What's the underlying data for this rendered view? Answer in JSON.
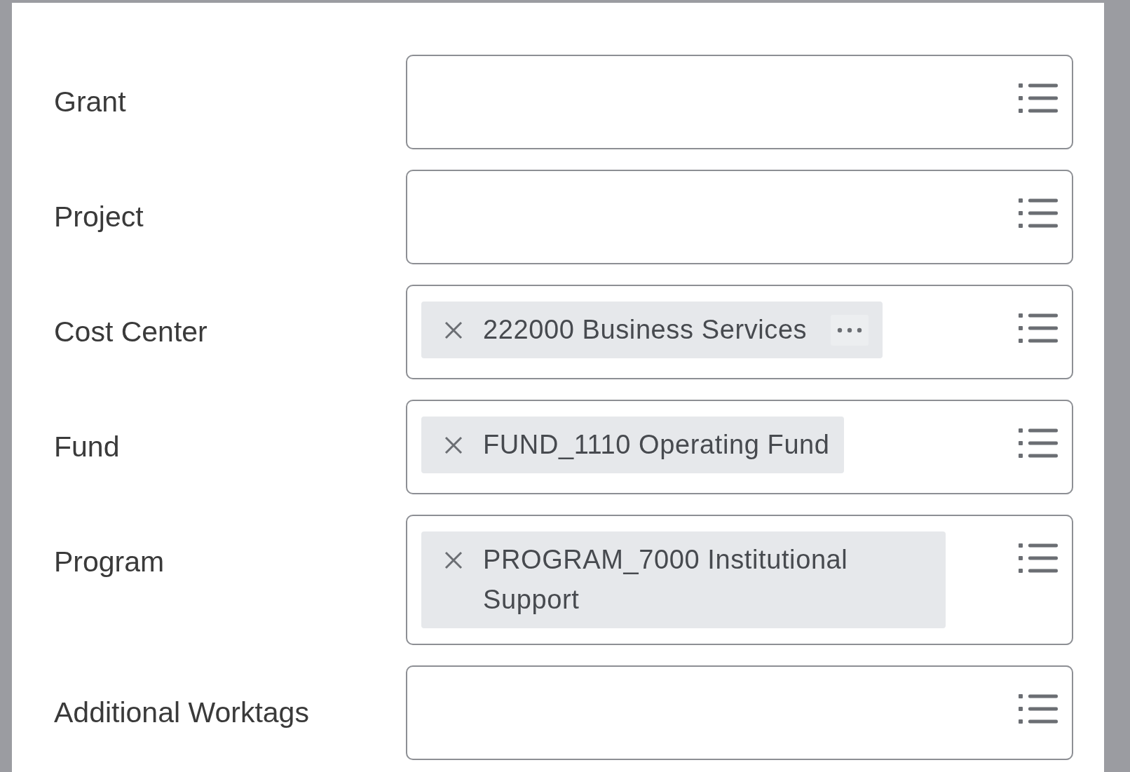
{
  "fields": [
    {
      "label": "Grant"
    },
    {
      "label": "Project"
    },
    {
      "label": "Cost Center",
      "chips": [
        {
          "text": "222000 Business Services",
          "has_menu": true
        }
      ]
    },
    {
      "label": "Fund",
      "chips": [
        {
          "text": "FUND_1110 Operating Fund",
          "has_menu": false
        }
      ]
    },
    {
      "label": "Program",
      "chips": [
        {
          "text": "PROGRAM_7000 Institutional Support",
          "has_menu": false
        }
      ]
    },
    {
      "label": "Additional Worktags"
    }
  ]
}
